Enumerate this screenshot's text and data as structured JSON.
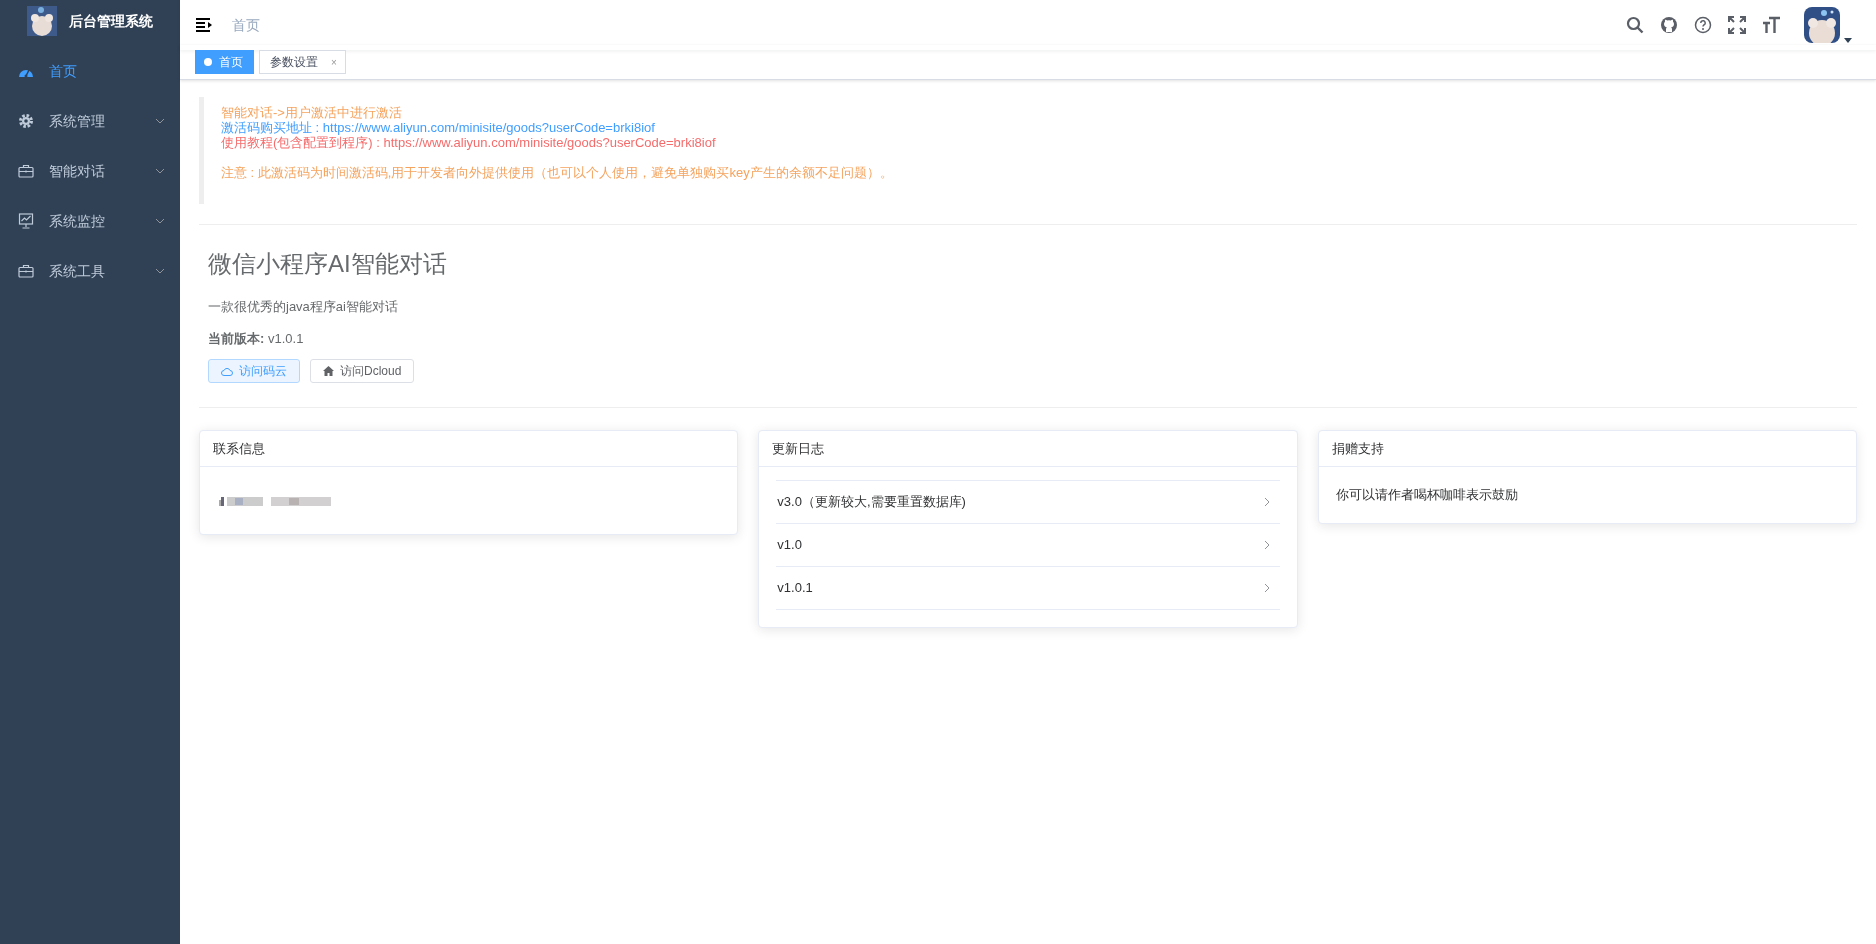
{
  "sidebar": {
    "title": "后台管理系统",
    "items": [
      {
        "label": "首页",
        "selected": true
      },
      {
        "label": "系统管理",
        "selected": false,
        "expanded": false
      },
      {
        "label": "智能对话",
        "selected": false,
        "expanded": false
      },
      {
        "label": "系统监控",
        "selected": false,
        "expanded": false
      },
      {
        "label": "系统工具",
        "selected": false,
        "expanded": false
      }
    ]
  },
  "header": {
    "breadcrumb": "首页"
  },
  "tabs": [
    {
      "label": "首页",
      "selected": true
    },
    {
      "label": "参数设置",
      "selected": false,
      "close": "×"
    }
  ],
  "notice": [
    {
      "kind": "warning",
      "text": "智能对话->用户激活中进行激活"
    },
    {
      "kind": "info",
      "text": "激活码购买地址 : https://www.aliyun.com/minisite/goods?userCode=brki8iof"
    },
    {
      "kind": "danger",
      "text": "使用教程(包含配置到程序) : https://www.aliyun.com/minisite/goods?userCode=brki8iof"
    },
    {
      "kind": "spacer"
    },
    {
      "kind": "warning",
      "text": "注意 : 此激活码为时间激活码,用于开发者向外提供使用（也可以个人使用，避免单独购买key产生的余额不足问题）。"
    }
  ],
  "intro": {
    "title": "微信小程序AI智能对话",
    "description": "一款很优秀的java程序ai智能对话",
    "version": "**当前版本:** v1.0.1",
    "buttons": [
      {
        "label": "访问码云",
        "primary": true
      },
      {
        "label": "访问Dcloud",
        "primary": false
      }
    ]
  },
  "cards": [
    {
      "title": "联系信息",
      "kind": "redacted"
    },
    {
      "title": "更新日志",
      "kind": "list",
      "items": [
        "v3.0（更新较大,需要重置数据库)",
        "v1.0",
        "v1.0.1"
      ]
    },
    {
      "title": "捐赠支持",
      "kind": "text",
      "text": "你可以请作者喝杯咖啡表示鼓励"
    }
  ]
}
